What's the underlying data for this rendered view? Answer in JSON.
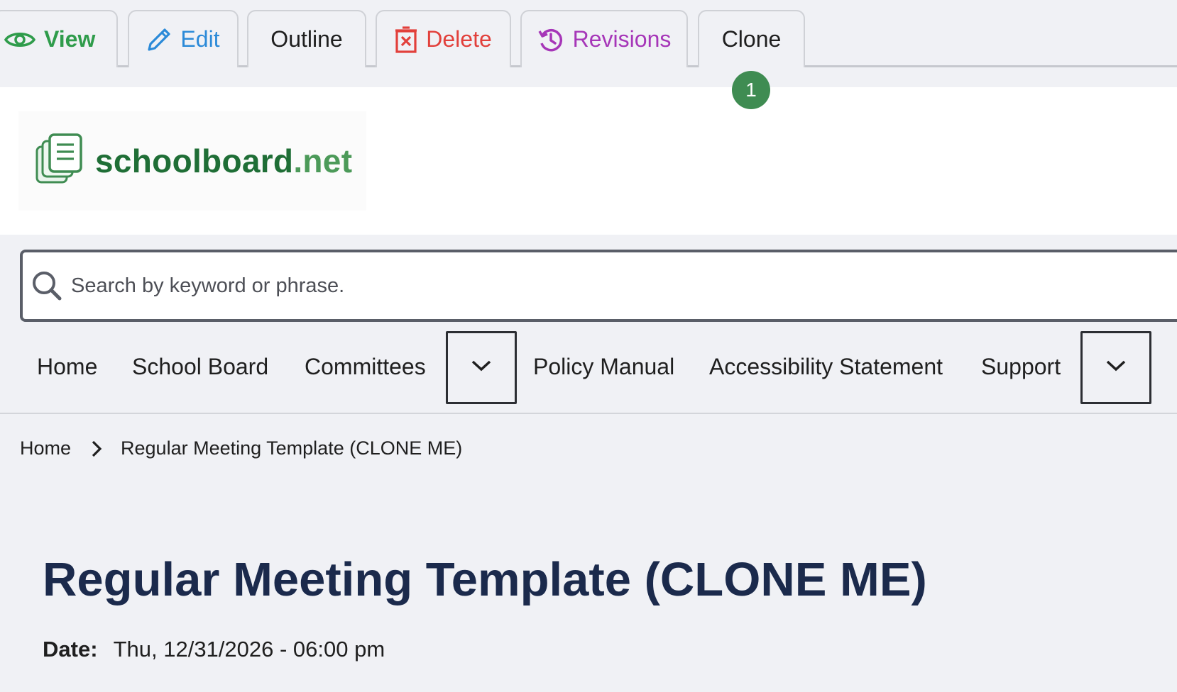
{
  "tabs": {
    "view": "View",
    "edit": "Edit",
    "outline": "Outline",
    "delete": "Delete",
    "revisions": "Revisions",
    "clone": "Clone"
  },
  "badge": "1",
  "logo": {
    "part1": "schoolboard",
    "part2": ".net"
  },
  "search": {
    "placeholder": "Search by keyword or phrase."
  },
  "nav": {
    "home": "Home",
    "school_board": "School Board",
    "committees": "Committees",
    "policy_manual": "Policy Manual",
    "accessibility": "Accessibility Statement",
    "support": "Support"
  },
  "breadcrumb": {
    "home": "Home",
    "current": "Regular Meeting Template (CLONE ME)"
  },
  "page": {
    "title": "Regular Meeting Template (CLONE ME)",
    "date_label": "Date:",
    "date_value": "Thu, 12/31/2026 - 06:00 pm"
  },
  "colors": {
    "view": "#2f9c4b",
    "edit": "#2b8ad8",
    "delete": "#e2403b",
    "revisions": "#a636b8",
    "badge": "#3f8c52",
    "title": "#1b2a4c",
    "logo_dark": "#1f6e36",
    "logo_light": "#4c9a59"
  },
  "icons": {
    "view": "eye-icon",
    "edit": "pencil-icon",
    "delete": "delete-icon",
    "revisions": "history-icon",
    "logo": "documents-icon",
    "search": "search-icon",
    "nav_toggle": "chevron-down-icon",
    "breadcrumb_separator": "chevron-right-icon"
  }
}
